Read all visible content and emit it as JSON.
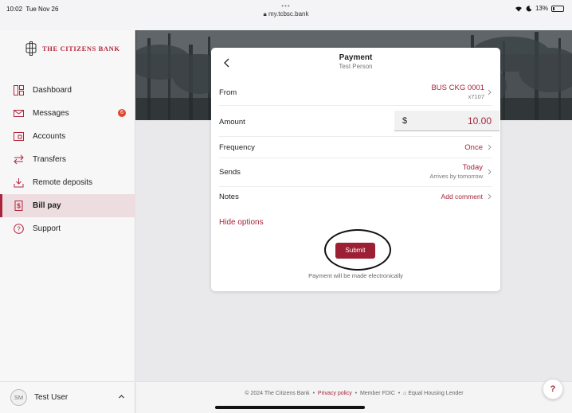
{
  "status_bar": {
    "time": "10:02",
    "date": "Tue Nov 26",
    "dots": "•••",
    "url": "my.tcbsc.bank",
    "battery": "13%"
  },
  "brand": {
    "name": "The Citizens Bank",
    "accent": "#a8243a"
  },
  "sidebar": {
    "items": [
      {
        "label": "Dashboard",
        "icon": "dashboard-icon"
      },
      {
        "label": "Messages",
        "icon": "mail-icon",
        "badge": "6"
      },
      {
        "label": "Accounts",
        "icon": "accounts-icon"
      },
      {
        "label": "Transfers",
        "icon": "transfer-icon"
      },
      {
        "label": "Remote deposits",
        "icon": "deposit-icon"
      },
      {
        "label": "Bill pay",
        "icon": "billpay-icon",
        "active": true
      },
      {
        "label": "Support",
        "icon": "help-circle-icon"
      }
    ],
    "user": {
      "initials": "SM",
      "name": "Test User"
    }
  },
  "payment": {
    "title": "Payment",
    "payee": "Test Person",
    "from_label": "From",
    "from_account": "BUS CKG 0001",
    "from_mask": "x7107",
    "amount_label": "Amount",
    "currency": "$",
    "amount": "10.00",
    "frequency_label": "Frequency",
    "frequency_value": "Once",
    "sends_label": "Sends",
    "sends_value": "Today",
    "arrives": "Arrives by tomorrow",
    "notes_label": "Notes",
    "notes_action": "Add comment",
    "hide_options": "Hide options",
    "submit": "Submit",
    "electronic_note": "Payment will be made electronically"
  },
  "footer": {
    "copyright": "© 2024 The Citizens Bank",
    "privacy": "Privacy policy",
    "fdic": "Member FDIC",
    "housing": "Equal Housing Lender",
    "sep": "•"
  },
  "help": "?"
}
